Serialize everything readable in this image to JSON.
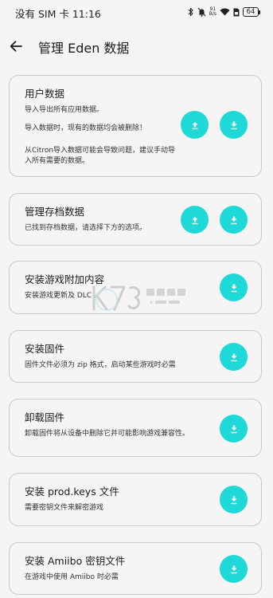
{
  "status_bar": {
    "carrier_time": "没有 SIM 卡 11:16",
    "net_speed_value": "91",
    "net_speed_unit": "B/s",
    "battery": "64"
  },
  "header": {
    "title": "管理 Eden 数据"
  },
  "cards": [
    {
      "title": "用户数据",
      "desc": [
        "导入导出所有应用数据。",
        "导入数据时，现有的数据均会被删除！",
        "从Citron导入数据可能会导致问题，建议手动导入所有需要的数据。"
      ]
    },
    {
      "title": "管理存档数据",
      "desc": [
        "已找到存档数据，请选择下方的选项。"
      ]
    },
    {
      "title": "安装游戏附加内容",
      "desc": [
        "安装游戏更新及 DLC"
      ]
    },
    {
      "title": "安装固件",
      "desc": [
        "固件文件必须为 zip 格式，启动某些游戏时必需"
      ]
    },
    {
      "title": "卸载固件",
      "desc": [
        "卸载固件将从设备中删除它并可能影响游戏兼容性。"
      ]
    },
    {
      "title": "安装 prod.keys 文件",
      "desc": [
        "需要密钥文件来解密游戏"
      ]
    },
    {
      "title": "安装 Amiibo 密钥文件",
      "desc": [
        "在游戏中使用 Amiibo 时必需"
      ]
    }
  ],
  "icons": {
    "back": "arrow-left-icon",
    "export": "upload-icon",
    "import": "download-icon"
  },
  "colors": {
    "accent": "#1fd9d9",
    "background": "#f5f5f5",
    "card_border": "#c9c9c9"
  }
}
